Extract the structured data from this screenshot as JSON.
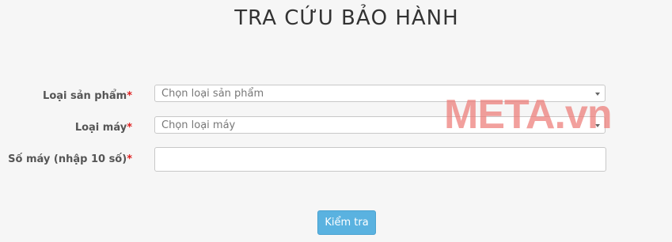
{
  "page": {
    "title": "TRA CỨU BẢO HÀNH"
  },
  "form": {
    "product_type": {
      "label": "Loại sản phẩm",
      "required_mark": "*",
      "placeholder": "Chọn loại sản phẩm"
    },
    "machine_type": {
      "label": "Loại máy",
      "required_mark": "*",
      "placeholder": "Chọn loại máy"
    },
    "serial": {
      "label": "Số máy (nhập 10 số)",
      "required_mark": "*",
      "value": ""
    },
    "submit_label": "Kiểm tra"
  },
  "watermark": {
    "text": "META.vn"
  },
  "colors": {
    "accent": "#5ab2e0",
    "required": "#e02020",
    "watermark": "#ec7873"
  }
}
